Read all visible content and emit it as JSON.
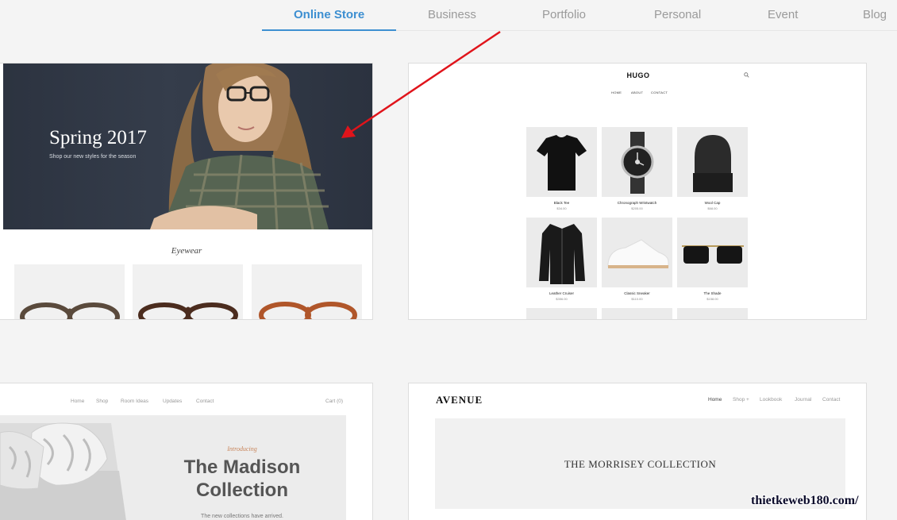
{
  "tabs": [
    "Online Store",
    "Business",
    "Portfolio",
    "Personal",
    "Event",
    "Blog"
  ],
  "active_tab": "Online Store",
  "templates": {
    "spring": {
      "hero_title": "Spring 2017",
      "hero_subtitle": "Shop our new styles for the season",
      "section_title": "Eyewear"
    },
    "hugo": {
      "logo": "HUGO",
      "nav": [
        "HOME",
        "ABOUT",
        "CONTACT"
      ],
      "products": [
        {
          "name": "Black Tee",
          "price": "$34.00"
        },
        {
          "name": "Chronograph Wristwatch",
          "price": "$205.00"
        },
        {
          "name": "Wool Cap",
          "price": "$68.00"
        },
        {
          "name": "Leather Cruiser",
          "price": "$356.00"
        },
        {
          "name": "Classic Sneaker",
          "price": "$110.00"
        },
        {
          "name": "The Shade",
          "price": "$158.00"
        }
      ]
    },
    "madison": {
      "nav": [
        "Home",
        "Shop",
        "Room Ideas",
        "Updates",
        "Contact"
      ],
      "cart": "Cart (0)",
      "intro": "Introducing",
      "title_line1": "The Madison",
      "title_line2": "Collection",
      "subtitle": "The new collections have arrived."
    },
    "avenue": {
      "logo": "AVENUE",
      "nav": [
        "Home",
        "Shop +",
        "Lookbook",
        "Journal",
        "Contact"
      ],
      "banner_text": "THE MORRISEY COLLECTION"
    }
  },
  "watermark": "thietkeweb180.com/",
  "colors": {
    "accent": "#3d8fd1",
    "arrow": "#e0141b",
    "background": "#f4f4f4"
  }
}
